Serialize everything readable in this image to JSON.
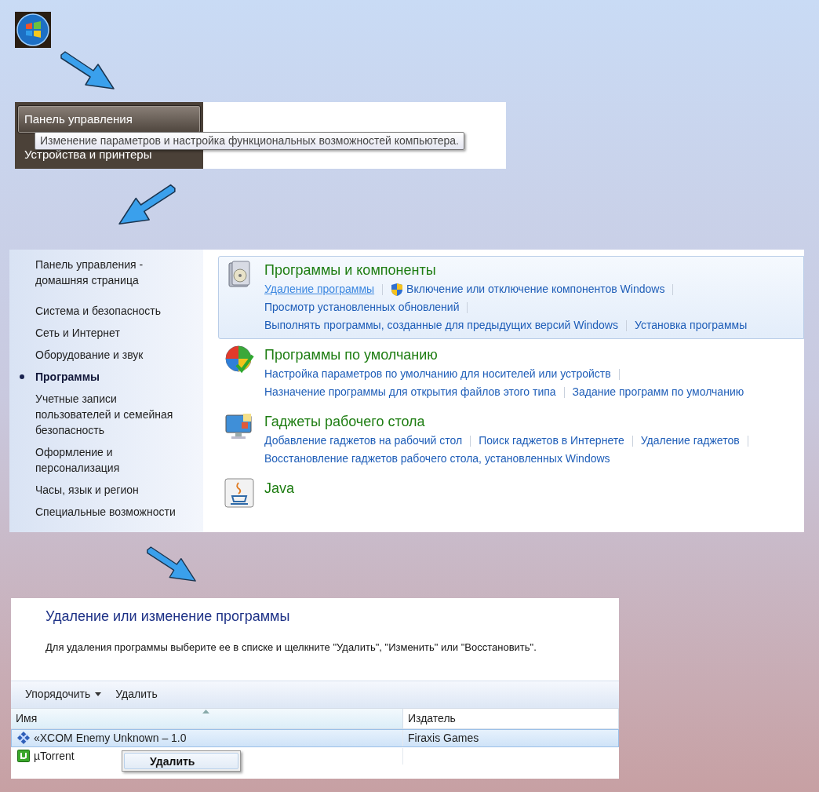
{
  "start_menu": {
    "items": [
      {
        "label": "Панель управления",
        "selected": true
      },
      {
        "label": "Устройства и принтеры",
        "selected": false
      }
    ],
    "tooltip": "Изменение параметров и настройка функциональных возможностей компьютера."
  },
  "control_panel": {
    "sidebar": [
      {
        "label": "Панель управления - домашняя страница",
        "selected": false
      },
      {
        "label": "Система и безопасность",
        "selected": false
      },
      {
        "label": "Сеть и Интернет",
        "selected": false
      },
      {
        "label": "Оборудование и звук",
        "selected": false
      },
      {
        "label": "Программы",
        "selected": true
      },
      {
        "label": "Учетные записи пользователей и семейная безопасность",
        "selected": false
      },
      {
        "label": "Оформление и персонализация",
        "selected": false
      },
      {
        "label": "Часы, язык и регион",
        "selected": false
      },
      {
        "label": "Специальные возможности",
        "selected": false
      }
    ],
    "categories": [
      {
        "title": "Программы и компоненты",
        "kind": "box",
        "selected": true,
        "rows": [
          [
            {
              "text": "Удаление программы",
              "hovered": true,
              "shield": false,
              "separator": true
            },
            {
              "text": "Включение или отключение компонентов Windows",
              "hovered": false,
              "shield": true,
              "separator": true
            }
          ],
          [
            {
              "text": "Просмотр установленных обновлений",
              "hovered": false,
              "shield": false,
              "separator": true
            }
          ],
          [
            {
              "text": "Выполнять программы, созданные для предыдущих версий Windows",
              "hovered": false,
              "shield": false,
              "separator": true
            },
            {
              "text": "Установка программы",
              "hovered": false,
              "shield": false,
              "separator": false
            }
          ]
        ]
      },
      {
        "title": "Программы по умолчанию",
        "kind": "defaults",
        "selected": false,
        "rows": [
          [
            {
              "text": "Настройка параметров по умолчанию для носителей или устройств",
              "hovered": false,
              "shield": false,
              "separator": true
            }
          ],
          [
            {
              "text": "Назначение программы для открытия файлов этого типа",
              "hovered": false,
              "shield": false,
              "separator": true
            },
            {
              "text": "Задание программ по умолчанию",
              "hovered": false,
              "shield": false,
              "separator": false
            }
          ]
        ]
      },
      {
        "title": "Гаджеты рабочего стола",
        "kind": "gadgets",
        "selected": false,
        "rows": [
          [
            {
              "text": "Добавление гаджетов на рабочий стол",
              "hovered": false,
              "shield": false,
              "separator": true
            },
            {
              "text": "Поиск гаджетов в Интернете",
              "hovered": false,
              "shield": false,
              "separator": true
            },
            {
              "text": "Удаление гаджетов",
              "hovered": false,
              "shield": false,
              "separator": true
            }
          ],
          [
            {
              "text": "Восстановление гаджетов рабочего стола, установленных Windows",
              "hovered": false,
              "shield": false,
              "separator": false
            }
          ]
        ]
      },
      {
        "title": "Java",
        "kind": "java",
        "selected": false
      }
    ]
  },
  "programs": {
    "title": "Удаление или изменение программы",
    "instruction": "Для удаления программы выберите ее в списке и щелкните \"Удалить\", \"Изменить\" или \"Восстановить\".",
    "toolbar": [
      {
        "label": "Упорядочить",
        "kind": "dropdown"
      },
      {
        "label": "Удалить",
        "kind": "plain"
      }
    ],
    "columns": [
      {
        "label": "Имя",
        "sorted": true
      },
      {
        "label": "Издатель",
        "sorted": false
      }
    ],
    "rows": [
      {
        "name": "«XCOM Enemy Unknown – 1.0",
        "publisher": "Firaxis Games",
        "kind": "xcom",
        "selected": true
      },
      {
        "name": "µTorrent",
        "kind": "utorrent",
        "selected": false
      }
    ],
    "context_menu": [
      "Удалить"
    ]
  }
}
